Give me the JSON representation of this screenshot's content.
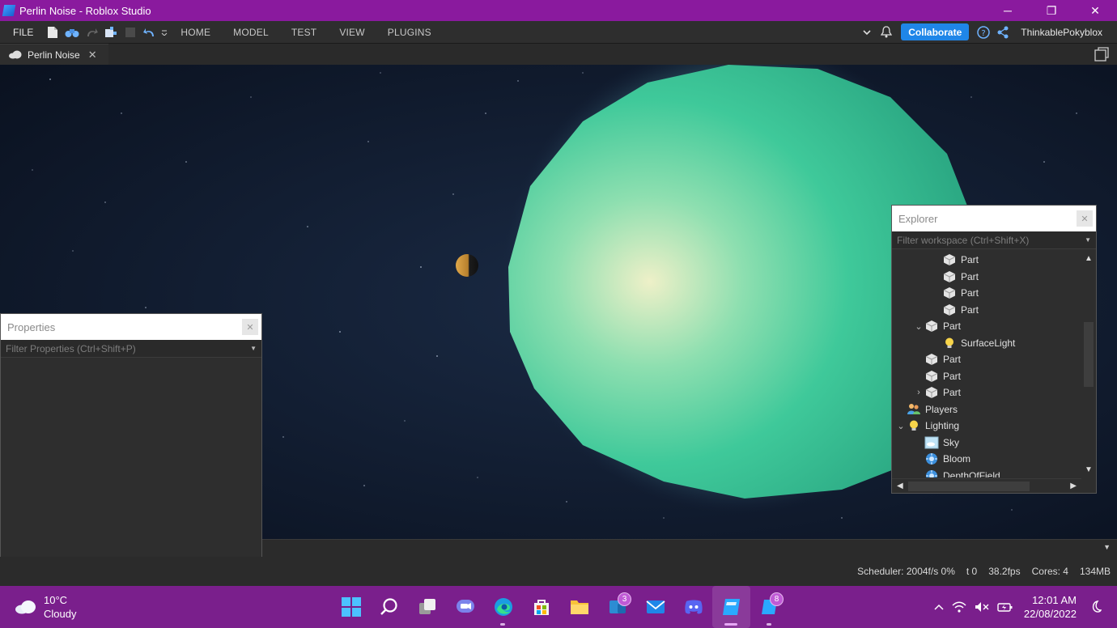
{
  "window": {
    "title": "Perlin Noise - Roblox Studio",
    "minimize": "─",
    "maximize": "❐",
    "close": "✕"
  },
  "menubar": {
    "file": "FILE",
    "tabs": [
      "HOME",
      "MODEL",
      "TEST",
      "VIEW",
      "PLUGINS"
    ],
    "collaborate": "Collaborate",
    "username": "ThinkablePokyblox"
  },
  "doc_tab": {
    "label": "Perlin Noise",
    "close": "✕"
  },
  "properties": {
    "title": "Properties",
    "filter_placeholder": "Filter Properties (Ctrl+Shift+P)",
    "close": "✕"
  },
  "explorer": {
    "title": "Explorer",
    "filter_placeholder": "Filter workspace (Ctrl+Shift+X)",
    "close": "✕",
    "items": [
      {
        "label": "Part",
        "icon": "part-icon",
        "depth": 3,
        "chevron": ""
      },
      {
        "label": "Part",
        "icon": "part-icon",
        "depth": 3,
        "chevron": ""
      },
      {
        "label": "Part",
        "icon": "part-icon",
        "depth": 3,
        "chevron": ""
      },
      {
        "label": "Part",
        "icon": "part-icon",
        "depth": 3,
        "chevron": ""
      },
      {
        "label": "Part",
        "icon": "part-icon",
        "depth": 2,
        "chevron": "⌄"
      },
      {
        "label": "SurfaceLight",
        "icon": "light-bulb-icon",
        "depth": 3,
        "chevron": ""
      },
      {
        "label": "Part",
        "icon": "part-icon",
        "depth": 2,
        "chevron": ""
      },
      {
        "label": "Part",
        "icon": "part-icon",
        "depth": 2,
        "chevron": ""
      },
      {
        "label": "Part",
        "icon": "part-icon",
        "depth": 2,
        "chevron": "›"
      },
      {
        "label": "Players",
        "icon": "players-icon",
        "depth": 1,
        "chevron": ""
      },
      {
        "label": "Lighting",
        "icon": "light-bulb-icon",
        "depth": 1,
        "chevron": "⌄"
      },
      {
        "label": "Sky",
        "icon": "sky-icon",
        "depth": 2,
        "chevron": ""
      },
      {
        "label": "Bloom",
        "icon": "effect-icon",
        "depth": 2,
        "chevron": ""
      },
      {
        "label": "DepthOfField",
        "icon": "effect-icon",
        "depth": 2,
        "chevron": ""
      }
    ]
  },
  "status": {
    "scheduler": "Scheduler: 2004f/s 0%",
    "t": "t 0",
    "fps": "38.2fps",
    "cores": "Cores: 4",
    "memory": "134MB"
  },
  "taskbar": {
    "weather_temp": "10°C",
    "weather_desc": "Cloudy",
    "badge_teams": "3",
    "badge_studio": "8",
    "time": "12:01 AM",
    "date": "22/08/2022"
  },
  "colors": {
    "titlebar": "#8a1a9e",
    "taskbar": "#7a1f8c",
    "accent": "#1f86e8",
    "planet": "#3fc99a"
  }
}
